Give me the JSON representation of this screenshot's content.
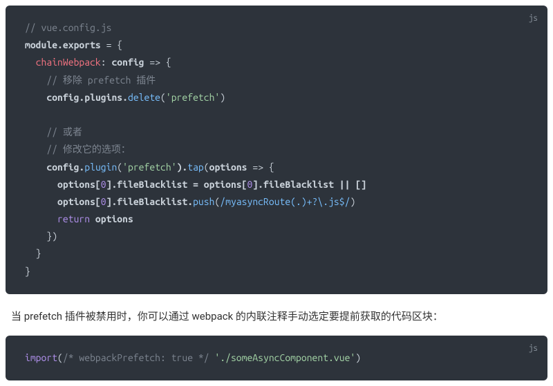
{
  "block1": {
    "lang": "js",
    "lines": {
      "l1_comment": "// vue.config.js",
      "l2_module": "module",
      "l2_exports": ".exports",
      "l2_eq": " = {",
      "l3_chain": "chainWebpack",
      "l3_colon": ": ",
      "l3_config": "config",
      "l3_arrow": " => {",
      "l4_comment": "// 移除 prefetch 插件",
      "l5_config": "config",
      "l5_plugins": ".plugins.",
      "l5_delete": "delete",
      "l5_p1": "(",
      "l5_str": "'prefetch'",
      "l5_p2": ")",
      "l7_comment": "// 或者",
      "l8_comment": "// 修改它的选项：",
      "l9_config": "config",
      "l9_dot1": ".",
      "l9_plugin": "plugin",
      "l9_p1": "(",
      "l9_str": "'prefetch'",
      "l9_p2": ").",
      "l9_tap": "tap",
      "l9_p3": "(",
      "l9_options": "options",
      "l9_arrow": " => {",
      "l10_a": "options[",
      "l10_num1": "0",
      "l10_b": "].fileBlacklist = options[",
      "l10_num2": "0",
      "l10_c": "].fileBlacklist || []",
      "l11_a": "options[",
      "l11_num": "0",
      "l11_b": "].fileBlacklist.",
      "l11_push": "push",
      "l11_p1": "(",
      "l11_regex": "/myasyncRoute(.)+?\\.js$/",
      "l11_p2": ")",
      "l12_return": "return",
      "l12_options": " options",
      "l13": "})",
      "l14": "}",
      "l15": "}"
    }
  },
  "prose_text": "当 prefetch 插件被禁用时，你可以通过 webpack 的内联注释手动选定要提前获取的代码区块：",
  "block2": {
    "lang": "js",
    "lines": {
      "import": "import",
      "p1": "(",
      "comment": "/* webpackPrefetch: true */",
      "space": " ",
      "str": "'./someAsyncComponent.vue'",
      "p2": ")"
    }
  }
}
